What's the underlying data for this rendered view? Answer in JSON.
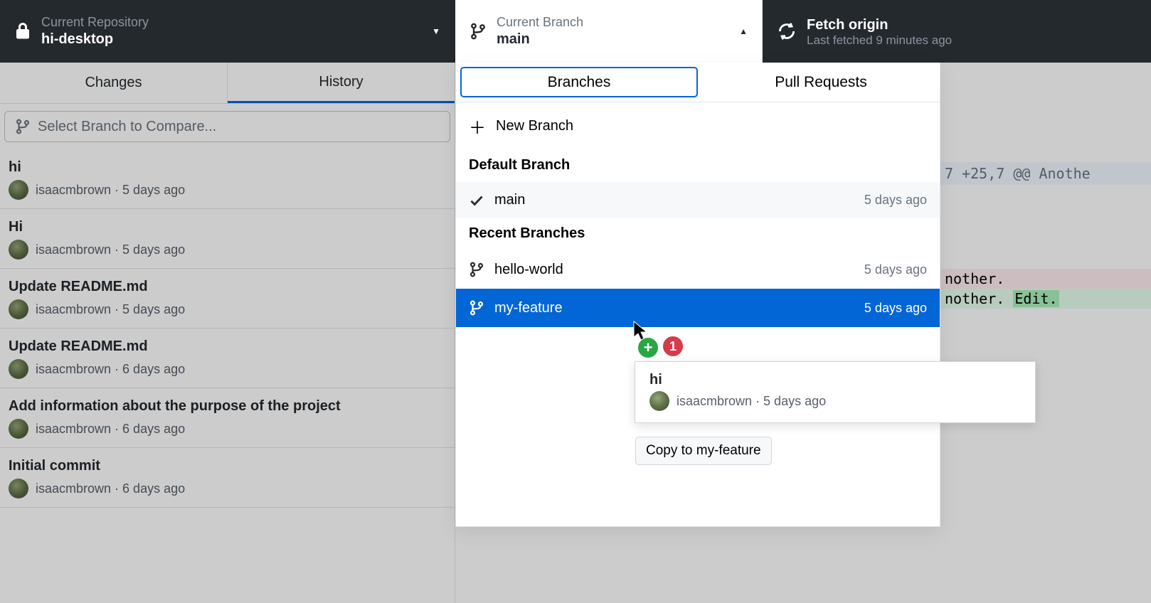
{
  "topbar": {
    "repo": {
      "label": "Current Repository",
      "name": "hi-desktop"
    },
    "branch": {
      "label": "Current Branch",
      "name": "main"
    },
    "fetch": {
      "label": "Fetch origin",
      "status": "Last fetched 9 minutes ago"
    }
  },
  "tabs": {
    "changes": "Changes",
    "history": "History"
  },
  "compare_placeholder": "Select Branch to Compare...",
  "commits": [
    {
      "title": "hi",
      "author": "isaacmbrown",
      "time": "5 days ago"
    },
    {
      "title": "Hi",
      "author": "isaacmbrown",
      "time": "5 days ago"
    },
    {
      "title": "Update README.md",
      "author": "isaacmbrown",
      "time": "5 days ago"
    },
    {
      "title": "Update README.md",
      "author": "isaacmbrown",
      "time": "6 days ago"
    },
    {
      "title": "Add information about the purpose of the project",
      "author": "isaacmbrown",
      "time": "6 days ago"
    },
    {
      "title": "Initial commit",
      "author": "isaacmbrown",
      "time": "6 days ago"
    }
  ],
  "popover": {
    "tabs": {
      "branches": "Branches",
      "pulls": "Pull Requests"
    },
    "new_branch": "New Branch",
    "default_header": "Default Branch",
    "recent_header": "Recent Branches",
    "default_branch": {
      "name": "main",
      "time": "5 days ago"
    },
    "recent": [
      {
        "name": "hello-world",
        "time": "5 days ago"
      },
      {
        "name": "my-feature",
        "time": "5 days ago"
      }
    ]
  },
  "drag": {
    "commit": {
      "title": "hi",
      "author": "isaacmbrown",
      "time": "5 days ago"
    },
    "count": "1",
    "tooltip": "Copy to my-feature"
  },
  "diff": {
    "hunk": "7 +25,7 @@ Anothe",
    "line_del": "nother.",
    "line_add_prefix": "nother.",
    "line_add_word": "Edit."
  },
  "sep": " · "
}
